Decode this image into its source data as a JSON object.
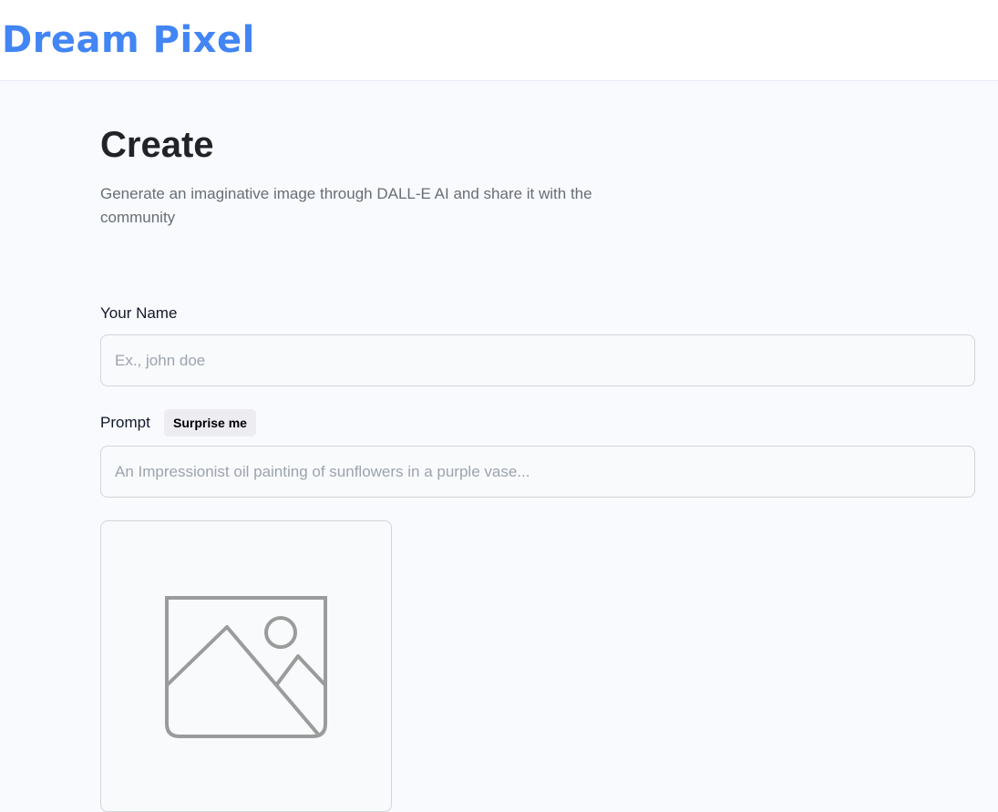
{
  "header": {
    "logo_text": "Dream Pixel"
  },
  "page": {
    "title": "Create",
    "subtitle": "Generate an imaginative image through DALL-E AI and share it with the community"
  },
  "form": {
    "name_label": "Your Name",
    "name_placeholder": "Ex., john doe",
    "name_value": "",
    "prompt_label": "Prompt",
    "surprise_button_label": "Surprise me",
    "prompt_placeholder": "An Impressionist oil painting of sunflowers in a purple vase...",
    "prompt_value": ""
  },
  "preview": {
    "icon": "image-placeholder-icon"
  },
  "colors": {
    "brand": "#4285f4",
    "title": "#222328",
    "subtitle": "#666e75",
    "background": "#f9fafe"
  }
}
